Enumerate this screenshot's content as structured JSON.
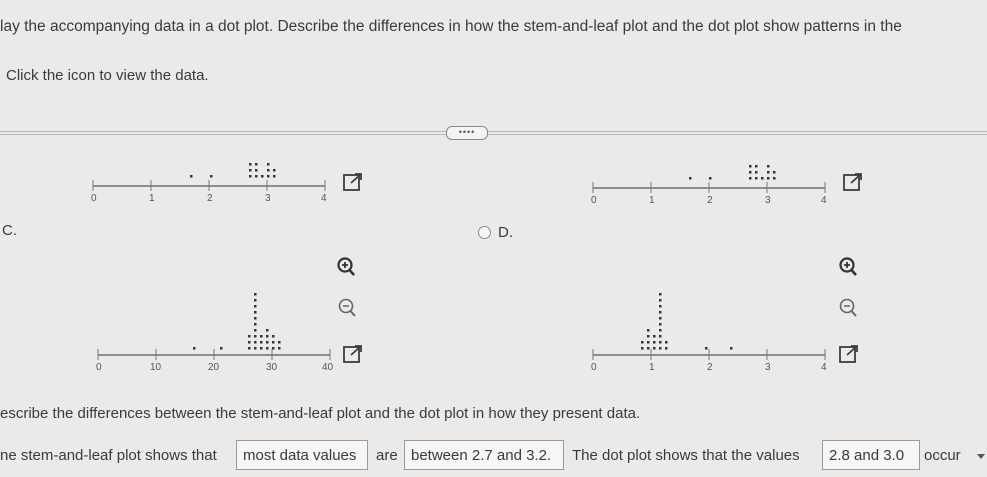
{
  "instruction": "lay the accompanying data in a dot plot. Describe the differences in how the stem-and-leaf plot and the dot plot show patterns in the",
  "click_text": "Click the icon to view the data.",
  "more_button": "••••",
  "option_c": {
    "label": "C.",
    "plot1_ticks": [
      "0",
      "1",
      "2",
      "3",
      "4"
    ],
    "plot2_ticks": [
      "0",
      "10",
      "20",
      "30",
      "40"
    ]
  },
  "option_d": {
    "label": "D.",
    "plot1_ticks": [
      "0",
      "1",
      "2",
      "3",
      "4"
    ],
    "plot2_ticks": [
      "0",
      "1",
      "2",
      "3",
      "4"
    ]
  },
  "describe_prompt": "escribe the differences between the stem-and-leaf plot and the dot plot in how they present data.",
  "answer_line": {
    "seg1": "ne stem-and-leaf plot shows that",
    "box1": "most data values",
    "seg2": "are",
    "box2": "between 2.7 and 3.2.",
    "seg3": "The dot plot shows that the values",
    "box3": "2.8 and 3.0",
    "seg4": "occur"
  },
  "icons": [
    "external-link-icon",
    "zoom-in-icon",
    "zoom-out-icon"
  ]
}
